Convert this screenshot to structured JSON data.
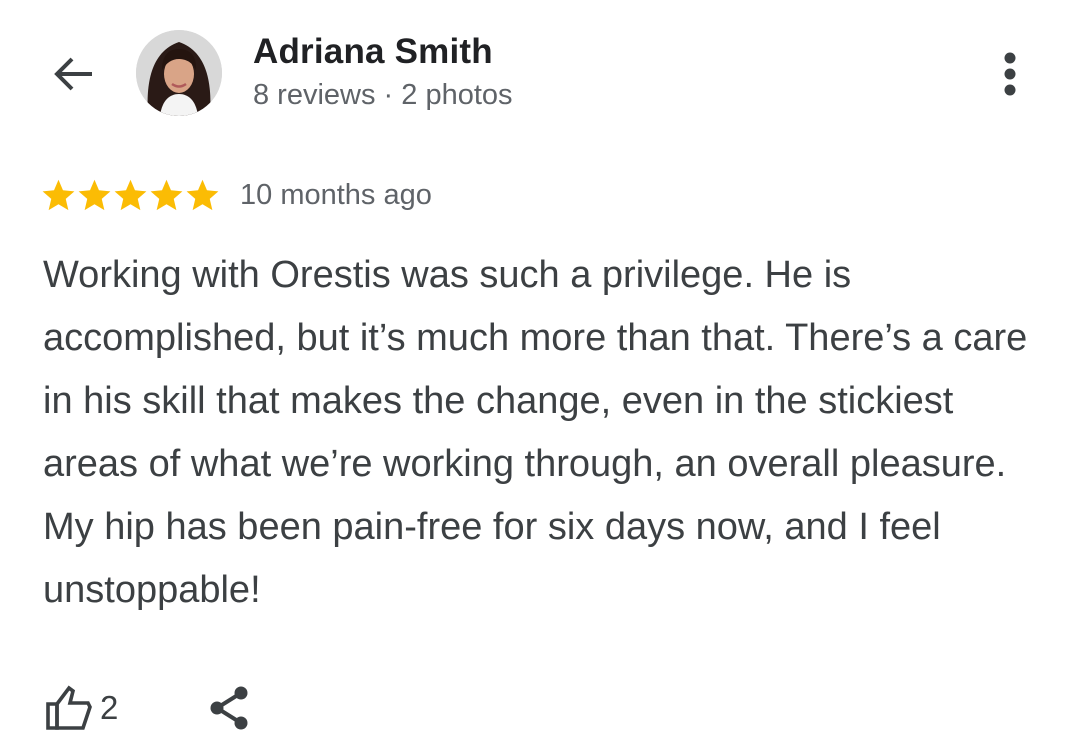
{
  "header": {
    "back_icon": "arrow-left-icon",
    "reviewer_name": "Adriana Smith",
    "reviewer_meta": "8 reviews · 2 photos",
    "more_icon": "more-vertical-icon"
  },
  "review": {
    "rating": 5,
    "max_rating": 5,
    "star_color": "#fbbc04",
    "date": "10 months ago",
    "text": "Working with Orestis was such a privilege. He is accomplished, but it’s much more than that. There’s a care in his skill that makes the change, even in the stickiest areas of what we’re working through, an overall pleasure. My hip has been pain-free for six days now, and I feel unstoppable!"
  },
  "actions": {
    "like_icon": "thumbs-up-icon",
    "like_count": "2",
    "share_icon": "share-icon"
  }
}
